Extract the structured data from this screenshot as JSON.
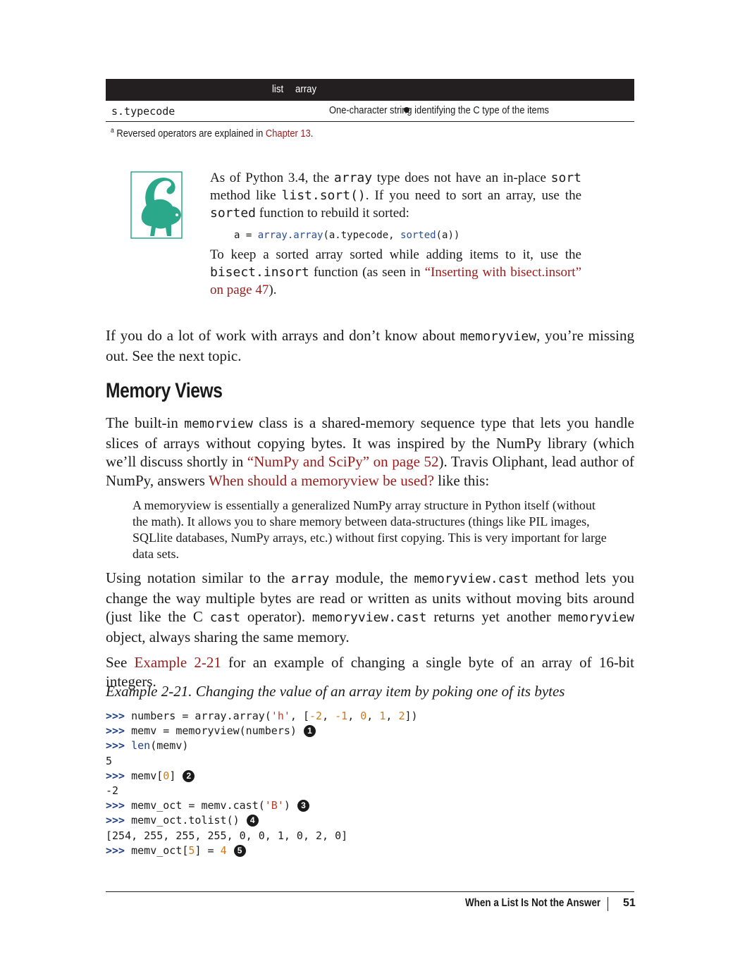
{
  "table": {
    "header_list": "list",
    "header_array": "array",
    "row_name": "s.typecode",
    "row_desc": "One-character string identifying the C type of the items",
    "footnote_marker": "a",
    "footnote_text": "Reversed operators are explained in ",
    "footnote_link": "Chapter 13",
    "footnote_end": "."
  },
  "tip": {
    "p1_a": "As of Python 3.4, the ",
    "p1_code1": "array",
    "p1_b": " type does not have an in-place ",
    "p1_code2": "sort",
    "p1_c": " method like ",
    "p1_code3": "list.sort()",
    "p1_d": ". If you need to sort an array, use the ",
    "p1_code4": "sorted",
    "p1_e": " function to rebuild it sorted:",
    "code_a": "a = ",
    "code_b": "array.array",
    "code_c": "(a.typecode, ",
    "code_d": "sorted",
    "code_e": "(a))",
    "p2_a": "To keep a sorted array sorted while adding items to it, use the ",
    "p2_code": "bisect.insort",
    "p2_b": " function (as seen in ",
    "p2_link": "“Inserting with bisect.insort” on page 47",
    "p2_c": ")."
  },
  "intro": {
    "a": "If you do a lot of work with arrays and don’t know about ",
    "code": "memoryview",
    "b": ", you’re missing out. See the next topic."
  },
  "section_title": "Memory Views",
  "p_memview": {
    "a": "The built-in ",
    "code": "memorview",
    "b": " class is a shared-memory sequence type that lets you handle slices of arrays without copying bytes. It was inspired by the NumPy library (which we’ll discuss shortly in ",
    "link1": "“NumPy and SciPy” on page 52",
    "c": "). Travis Oliphant, lead author of NumPy, answers ",
    "link2": "When should a memoryview be used?",
    "d": " like this:"
  },
  "quote": "A memoryview is essentially a generalized NumPy array structure in Python itself (without the math). It allows you to share memory between data-structures (things like PIL images, SQLlite databases, NumPy arrays, etc.) without first copying. This is very important for large data sets.",
  "p_cast": {
    "a": "Using notation similar to the ",
    "code1": "array",
    "b": " module, the ",
    "code2": "memoryview.cast",
    "c": " method lets you change the way multiple bytes are read or written as units without moving bits around (just like the C ",
    "code3": "cast",
    "d": " operator). ",
    "code4": "memoryview.cast",
    "e": " returns yet another ",
    "code5": "memoryview",
    "f": " object, always sharing the same memory."
  },
  "p_see": {
    "a": "See ",
    "link": "Example 2-21",
    "b": " for an example of changing a single byte of an array of 16-bit integers."
  },
  "example_title": "Example 2-21. Changing the value of an array item by poking one of its bytes",
  "code": {
    "prompt": ">>>",
    "l1_a": " numbers = array.array(",
    "l1_str": "'h'",
    "l1_b": ", [",
    "l1_n1": "-2",
    "l1_n2": "-1",
    "l1_n3": "0",
    "l1_n4": "1",
    "l1_n5": "2",
    "l2": " memv = memoryview(numbers)",
    "l3_a": " ",
    "l3_kw": "len",
    "l3_b": "(memv)",
    "o1": "5",
    "l4_a": " memv[",
    "l4_n": "0",
    "l4_b": "]",
    "o2": "-2",
    "l5_a": " memv_oct = memv.cast(",
    "l5_str": "'B'",
    "l5_b": ")",
    "l6": " memv_oct.tolist()",
    "o3": "[254, 255, 255, 255, 0, 0, 1, 0, 2, 0]",
    "l7_a": " memv_oct[",
    "l7_n1": "5",
    "l7_b": "] = ",
    "l7_n2": "4",
    "callouts": [
      "1",
      "2",
      "3",
      "4",
      "5"
    ]
  },
  "footer": {
    "title": "When a List Is Not the Answer",
    "page": "51"
  }
}
